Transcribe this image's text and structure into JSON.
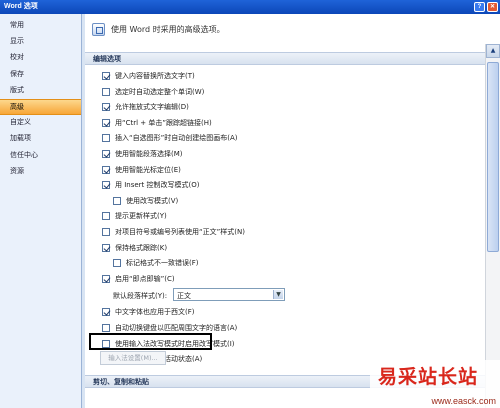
{
  "window": {
    "title": "Word 选项"
  },
  "sidebar": {
    "items": [
      {
        "label": "常用"
      },
      {
        "label": "显示"
      },
      {
        "label": "校对"
      },
      {
        "label": "保存"
      },
      {
        "label": "版式"
      },
      {
        "label": "高级",
        "selected": true
      },
      {
        "label": "自定义"
      },
      {
        "label": "加载项"
      },
      {
        "label": "信任中心"
      },
      {
        "label": "资源"
      }
    ]
  },
  "content": {
    "header": "使用 Word 时采用的高级选项。",
    "section_editing": "编辑选项",
    "options": [
      {
        "label": "键入内容替换所选文字(T)",
        "checked": true,
        "level": 1
      },
      {
        "label": "选定时自动选定整个单词(W)",
        "checked": false,
        "level": 1
      },
      {
        "label": "允许拖放式文字编辑(D)",
        "checked": true,
        "level": 1
      },
      {
        "label": "用“Ctrl + 单击”跟踪超链接(H)",
        "checked": true,
        "level": 1
      },
      {
        "label": "插入“自选图形”时自动创建绘图画布(A)",
        "checked": false,
        "level": 1
      },
      {
        "label": "使用智能段落选择(M)",
        "checked": true,
        "level": 1
      },
      {
        "label": "使用智能光标定位(E)",
        "checked": true,
        "level": 1
      },
      {
        "label": "用 Insert 控制改写模式(O)",
        "checked": true,
        "level": 1
      },
      {
        "label": "使用改写模式(V)",
        "checked": false,
        "level": 2
      },
      {
        "label": "提示更新样式(Y)",
        "checked": false,
        "level": 1
      },
      {
        "label": "对项目符号或编号列表使用“正文”样式(N)",
        "checked": false,
        "level": 1
      },
      {
        "label": "保持格式跟踪(K)",
        "checked": true,
        "level": 1
      },
      {
        "label": "标记格式不一致错误(F)",
        "checked": false,
        "level": 2
      },
      {
        "label": "启用“即点即输”(C)",
        "checked": true,
        "level": 1
      }
    ],
    "default_style": {
      "label": "默认段落样式(Y):",
      "value": "正文"
    },
    "options2": [
      {
        "label": "中文字体也应用于西文(F)",
        "checked": true,
        "level": 1
      },
      {
        "label": "自动切换键盘以匹配周围文字的语言(A)",
        "checked": false,
        "level": 1
      },
      {
        "label": "使用输入法改写模式时启用改写模式(I)",
        "checked": false,
        "level": 1
      },
      {
        "label": "输入法控制处于活动状态(A)",
        "checked": false,
        "level": 1,
        "disabled": true
      }
    ],
    "ime_settings_button": "输入法设置(M)...",
    "section_cut_paste": "剪切、复制和粘贴"
  },
  "watermark": {
    "text": "易采站长站",
    "sub": "www.easck.com"
  }
}
